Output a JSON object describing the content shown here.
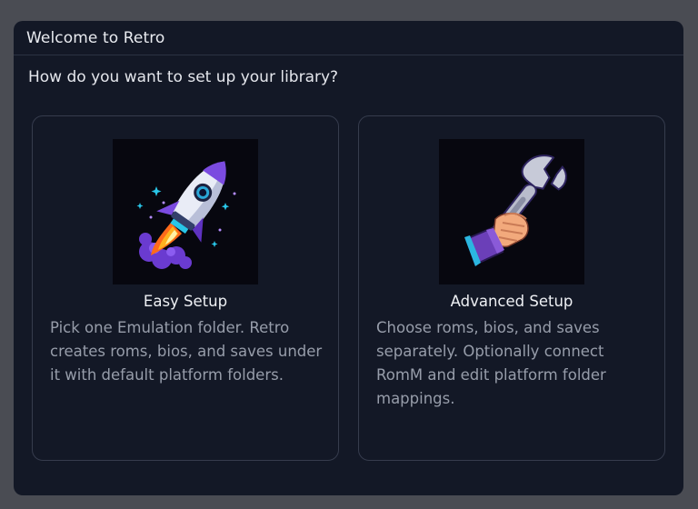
{
  "dialog": {
    "title": "Welcome to Retro",
    "question": "How do you want to set up your library?"
  },
  "options": [
    {
      "title": "Easy Setup",
      "description": "Pick one Emulation folder. Retro creates roms, bios, and saves under it with default platform folders.",
      "icon": "rocket-icon"
    },
    {
      "title": "Advanced Setup",
      "description": "Choose roms, bios, and saves separately. Optionally connect RomM and edit platform folder mappings.",
      "icon": "wrench-icon"
    }
  ],
  "colors": {
    "backdrop": "#4a4c53",
    "dialog_bg": "#131826",
    "card_border": "#363c4d",
    "title_text": "#eef0f4",
    "desc_text": "#979daa"
  }
}
